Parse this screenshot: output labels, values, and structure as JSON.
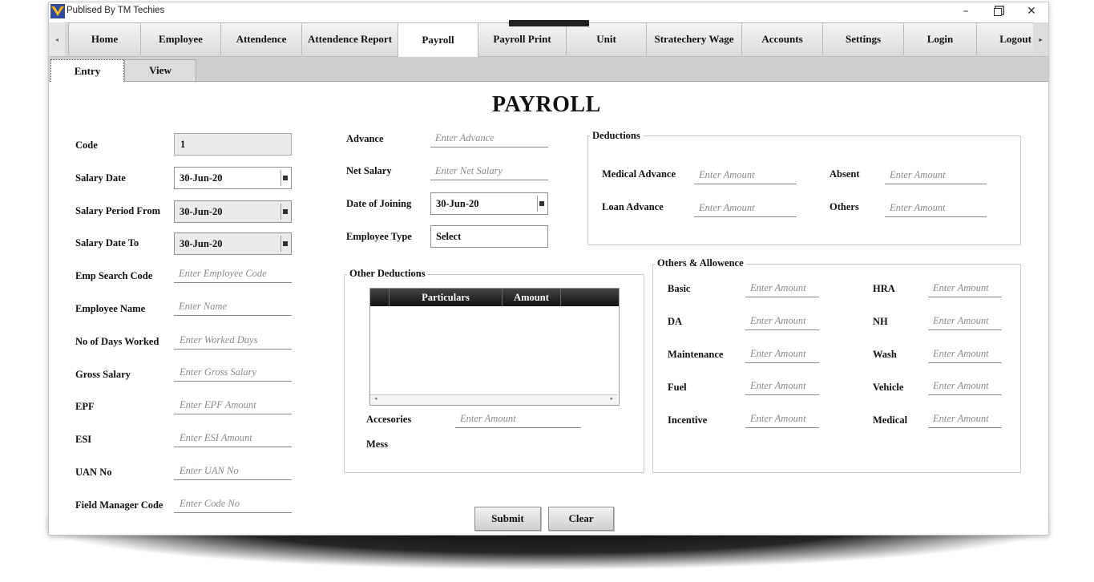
{
  "window": {
    "title": "Publised By TM Techies",
    "minimize": "–",
    "maximize": "🗗",
    "close": "✕"
  },
  "menu": {
    "scroll_left": "◂",
    "scroll_right": "▸",
    "tabs": [
      "Home",
      "Employee",
      "Attendence",
      "Attendence Report",
      "Payroll",
      "Payroll Print",
      "Unit",
      "Stratechery Wage",
      "Accounts",
      "Settings",
      "Login",
      "Logout"
    ],
    "active": "Payroll"
  },
  "subtabs": {
    "entry": "Entry",
    "view": "View"
  },
  "page": {
    "title": "PAYROLL"
  },
  "left": {
    "code_label": "Code",
    "code_value": "1",
    "salary_date_label": "Salary Date",
    "salary_date_value": "30-Jun-20",
    "period_from_label": "Salary Period From",
    "period_from_value": "30-Jun-20",
    "date_to_label": "Salary Date To",
    "date_to_value": "30-Jun-20",
    "emp_search_label": "Emp Search Code",
    "emp_search_ph": "Enter Employee Code",
    "emp_name_label": "Employee Name",
    "emp_name_ph": "Enter Name",
    "days_label": "No of Days Worked",
    "days_ph": "Enter Worked Days",
    "gross_label": "Gross Salary",
    "gross_ph": "Enter Gross Salary",
    "epf_label": "EPF",
    "epf_ph": "Enter EPF Amount",
    "esi_label": "ESI",
    "esi_ph": "Enter ESI Amount",
    "uan_label": "UAN No",
    "uan_ph": "Enter UAN No",
    "fm_label": "Field Manager Code",
    "fm_ph": "Enter Code No"
  },
  "middle": {
    "advance_label": "Advance",
    "advance_ph": "Enter Advance",
    "net_label": "Net Salary",
    "net_ph": "Enter Net Salary",
    "doj_label": "Date of Joining",
    "doj_value": "30-Jun-20",
    "type_label": "Employee Type",
    "type_value": "Select"
  },
  "deductions": {
    "title": "Deductions",
    "medical_label": "Medical Advance",
    "loan_label": "Loan Advance",
    "absent_label": "Absent",
    "others_label": "Others",
    "amount_ph": "Enter Amount"
  },
  "other_deductions": {
    "title": "Other Deductions",
    "columns": [
      "Particulars",
      "Amount"
    ],
    "scroll_left": "◂",
    "scroll_right": "▸",
    "accesories_label": "Accesories",
    "accesories_ph": "Enter Amount",
    "mess_label": "Mess"
  },
  "allowance": {
    "title": "Others & Allowence",
    "amount_ph": "Enter Amount",
    "left": [
      "Basic",
      "DA",
      "Maintenance",
      "Fuel",
      "Incentive"
    ],
    "right": [
      "HRA",
      "NH",
      "Wash",
      "Vehicle",
      "Medical"
    ]
  },
  "actions": {
    "submit": "Submit",
    "clear": "Clear"
  }
}
